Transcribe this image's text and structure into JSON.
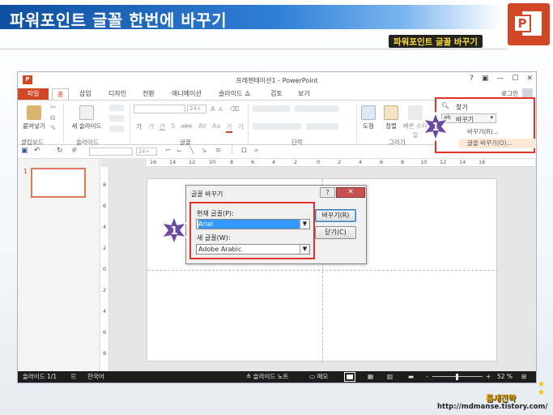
{
  "banner": {
    "title": "파워포인트 글꼴 한번에 바꾸기",
    "subtitle": "파워포인트 글꼴 바꾸기",
    "accent_color": "#1a5fb4"
  },
  "window": {
    "app_icon": "P",
    "title": "프레젠테이션1 - PowerPoint",
    "controls": [
      "?",
      "▣",
      "—",
      "☐",
      "✕"
    ],
    "login": "로그인"
  },
  "tabs": [
    "파일",
    "홈",
    "삽입",
    "디자인",
    "전환",
    "애니메이션",
    "슬라이드 쇼",
    "검토",
    "보기"
  ],
  "ribbon": {
    "paste": "붙여넣기",
    "new_slide": "새 슬라이드",
    "font_size": "24+",
    "font_style_glyphs": [
      "가",
      "가",
      "간",
      "S",
      "abc",
      "AV",
      "Aa",
      "가",
      "가"
    ],
    "shapes": "도형",
    "arrange": "정렬",
    "quick_styles": "빠른 스타일",
    "groups": [
      "클립보드",
      "슬라이드",
      "글꼴",
      "단락",
      "그리기"
    ]
  },
  "find_panel": {
    "find": "찾기",
    "replace": "바꾸기",
    "replace_item": "바꾸기(R)...",
    "replace_fonts_item": "글꼴 바꾸기(O)..."
  },
  "qat": {
    "font_size": "24+"
  },
  "ruler": {
    "horizontal": [
      "16",
      "14",
      "12",
      "10",
      "8",
      "6",
      "4",
      "2",
      "0",
      "2",
      "4",
      "6",
      "8",
      "10",
      "12",
      "14",
      "16"
    ],
    "vertical": [
      "8",
      "6",
      "4",
      "2",
      "0",
      "2",
      "4",
      "6",
      "8"
    ]
  },
  "thumbnail": {
    "number": "1"
  },
  "dialog": {
    "title": "글꼴 바꾸기",
    "help": "?",
    "close": "✕",
    "current_font_label": "현재 글꼴(P):",
    "current_font_value": "Arial",
    "new_font_label": "새 글꼴(W):",
    "new_font_value": "Adobe Arabic",
    "replace_button": "바꾸기(R)",
    "close_button": "닫기(C)"
  },
  "status": {
    "slide": "슬라이드 1/1",
    "language": "한국어",
    "notes": "슬라이드 노트",
    "comments": "메모",
    "zoom_minus": "-",
    "zoom_plus": "+",
    "zoom": "52 %"
  },
  "badges": {
    "ribbon": "1",
    "dialog": "1"
  },
  "footer": {
    "brand": "틈새전략",
    "url": "http://mdmanse.tistory.com/"
  }
}
